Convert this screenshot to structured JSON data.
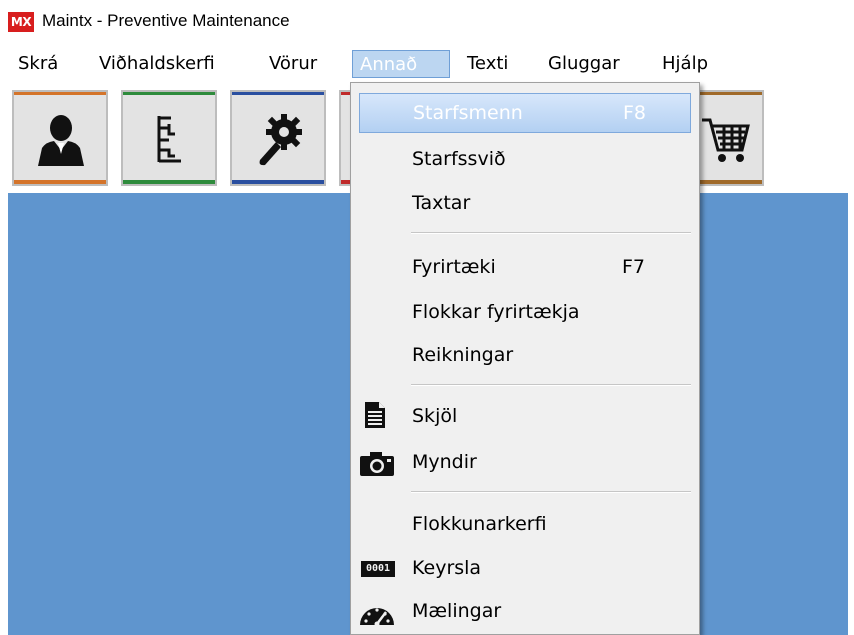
{
  "window": {
    "logo": "MX",
    "title": "Maintx - Preventive Maintenance"
  },
  "menubar": {
    "items": [
      "Skrá",
      "Viðhaldskerfi",
      "Vörur",
      "Annað",
      "Texti",
      "Gluggar",
      "Hjálp"
    ],
    "active_index": 3
  },
  "toolbar": {
    "buttons": [
      {
        "icon": "person-icon",
        "accent": "#d4742a"
      },
      {
        "icon": "tree-structure-icon",
        "accent": "#2e8b3c"
      },
      {
        "icon": "gear-wrench-icon",
        "accent": "#2a4fa0"
      },
      {
        "icon": "hidden-button-icon",
        "accent": "#c02a2a"
      },
      {
        "icon": "shopping-cart-icon",
        "accent": "#a06a2a"
      }
    ]
  },
  "dropdown": {
    "items": [
      {
        "label": "Starfsmenn",
        "shortcut": "F8",
        "highlighted": true
      },
      {
        "label": "Starfssvið",
        "shortcut": ""
      },
      {
        "label": "Taxtar",
        "shortcut": ""
      },
      {
        "label": "Fyrirtæki",
        "shortcut": "F7"
      },
      {
        "label": "Flokkar fyrirtækja",
        "shortcut": ""
      },
      {
        "label": "Reikningar",
        "shortcut": ""
      },
      {
        "label": "Skjöl",
        "shortcut": "",
        "icon": "document-icon"
      },
      {
        "label": "Myndir",
        "shortcut": "",
        "icon": "camera-icon"
      },
      {
        "label": "Flokkunarkerfi",
        "shortcut": ""
      },
      {
        "label": "Keyrsla",
        "shortcut": "",
        "icon": "counter-icon",
        "icon_text": "0001"
      },
      {
        "label": "Mælingar",
        "shortcut": "",
        "icon": "gauge-icon"
      }
    ]
  },
  "colors": {
    "workspace": "#5f95ce",
    "highlight": "#b3d0f2",
    "logo": "#d81e1e"
  }
}
